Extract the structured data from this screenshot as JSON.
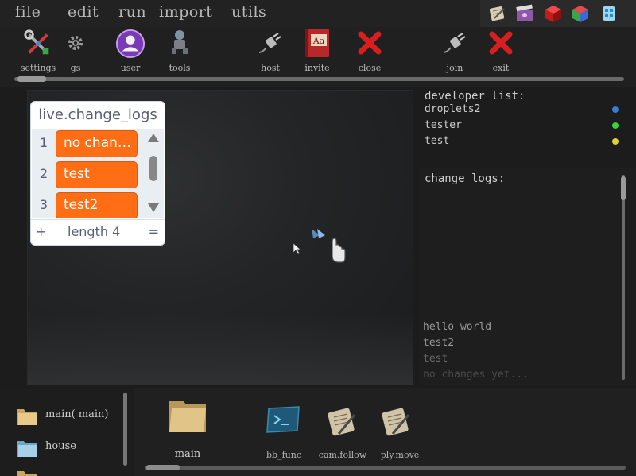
{
  "menu": {
    "items": [
      {
        "label": "file"
      },
      {
        "label": "edit"
      },
      {
        "label": "run"
      },
      {
        "label": "import"
      },
      {
        "label": "utils"
      }
    ]
  },
  "app_icons": [
    "scroll-icon",
    "clapperboard-icon",
    "red-cube-icon",
    "color-cube-icon",
    "blue-cubes-icon"
  ],
  "toolbar": {
    "buttons": [
      {
        "label": "settings",
        "icon": "settings-tools-icon"
      },
      {
        "label": "gs",
        "icon": "gear-icon"
      },
      {
        "label": "user",
        "icon": "user-icon"
      },
      {
        "label": "tools",
        "icon": "robot-icon"
      },
      {
        "label": "host",
        "icon": "plug-icon"
      },
      {
        "label": "invite",
        "icon": "book-icon",
        "glyph": "Aa"
      },
      {
        "label": "close",
        "icon": "red-x-icon"
      },
      {
        "label": "join",
        "icon": "plug-icon"
      },
      {
        "label": "exit",
        "icon": "red-x-icon"
      }
    ]
  },
  "list_monitor": {
    "title": "live.change_logs",
    "items": [
      {
        "index": "1",
        "value": "no changes yet..."
      },
      {
        "index": "2",
        "value": "test"
      },
      {
        "index": "3",
        "value": "test2"
      }
    ],
    "add_label": "+",
    "length_label": "length 4",
    "resize_label": "="
  },
  "developers": {
    "title": "developer list:",
    "items": [
      {
        "name": "droplets2",
        "color": "#3a7bd5"
      },
      {
        "name": "tester",
        "color": "#3ad13a"
      },
      {
        "name": "test",
        "color": "#e0d030"
      }
    ]
  },
  "change_logs": {
    "title": "change logs:",
    "entries": [
      {
        "text": "hello world",
        "color": "#9a9a9a"
      },
      {
        "text": "test2",
        "color": "#9a9a9a"
      },
      {
        "text": "test",
        "color": "#6a6a6a"
      },
      {
        "text": "no changes yet...",
        "color": "#4a4a4a"
      }
    ]
  },
  "folders": {
    "items": [
      {
        "label": "main( main)",
        "icon": "folder-icon"
      },
      {
        "label": "house",
        "icon": "folder-icon"
      }
    ]
  },
  "files": {
    "items": [
      {
        "label": "main",
        "icon": "folder-icon"
      },
      {
        "label": "bb_func",
        "icon": "terminal-icon"
      },
      {
        "label": "cam.follow",
        "icon": "scroll-icon"
      },
      {
        "label": "ply.move",
        "icon": "scroll-icon"
      }
    ]
  }
}
